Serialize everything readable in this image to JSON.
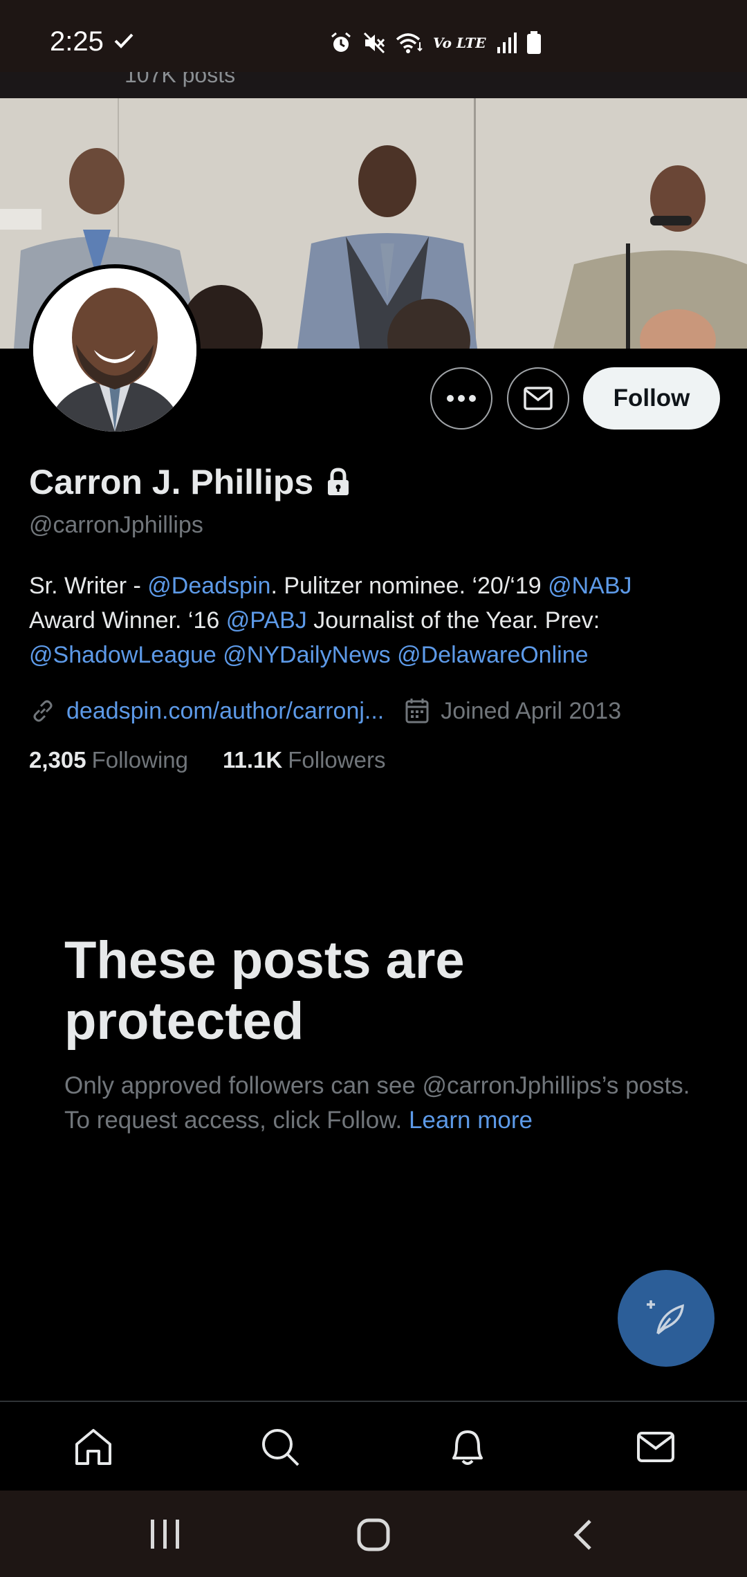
{
  "status_bar": {
    "time": "2:25",
    "icons": [
      "check-icon",
      "alarm-icon",
      "mute-icon",
      "wifi-icon",
      "volte-icon",
      "signal-icon",
      "battery-icon"
    ],
    "volte_label": "Vo LTE"
  },
  "header": {
    "posts_count": "107K posts"
  },
  "profile": {
    "display_name": "Carron J. Phillips",
    "handle": "@carronJphillips",
    "protected": true,
    "bio": {
      "line1_a": "Sr. Writer - ",
      "line1_link1": "@Deadspin",
      "line1_b": ". Pulitzer nominee. ‘20/‘19 ",
      "line1_link2": "@NABJ",
      "line2_a": "Award Winner. ‘16 ",
      "line2_link": "@PABJ",
      "line2_b": " Journalist of the Year. Prev:",
      "line3_link1": "@ShadowLeague",
      "line3_link2": "@NYDailyNews",
      "line3_link3": "@DelawareOnline"
    },
    "website": "deadspin.com/author/carronj...",
    "joined": "Joined April 2013",
    "following_count": "2,305",
    "following_label": "Following",
    "followers_count": "11.1K",
    "followers_label": "Followers"
  },
  "actions": {
    "follow_label": "Follow",
    "more_icon": "more-icon",
    "message_icon": "envelope-icon"
  },
  "protected_notice": {
    "title": "These posts are protected",
    "body": "Only approved followers can see @carronJphillips’s posts. To request access, click Follow. ",
    "learn_more": "Learn more"
  },
  "fab": {
    "icon": "compose-feather-icon"
  },
  "bottom_nav": {
    "items": [
      "home-icon",
      "search-icon",
      "notifications-icon",
      "messages-icon"
    ]
  },
  "system_nav": {
    "items": [
      "recent-apps-icon",
      "home-button-icon",
      "back-icon"
    ]
  },
  "colors": {
    "background": "#000000",
    "accent_link": "#5d9ae8",
    "muted_text": "#71767b",
    "fab": "#2c5e98",
    "follow_button_bg": "#eff3f4"
  }
}
